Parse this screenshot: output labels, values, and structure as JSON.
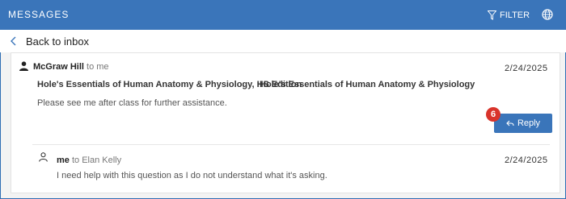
{
  "header": {
    "title": "MESSAGES",
    "filter_label": "FILTER"
  },
  "nav": {
    "back_label": "Back to inbox"
  },
  "thread": {
    "messages": [
      {
        "sender": "McGraw Hill",
        "recipient_text": "to me",
        "date": "2/24/2025",
        "books": [
          "Hole's Essentials of Human Anatomy & Physiology, HS Edition",
          "Hole's Essentials of Human Anatomy & Physiology"
        ],
        "body": "Please see me after class for further assistance."
      },
      {
        "sender": "me",
        "recipient_text": "to Elan Kelly",
        "date": "2/24/2025",
        "body": "I need help with this question as I do not understand what it's asking."
      }
    ],
    "reply_label": "Reply",
    "badge": "6"
  },
  "icons": {
    "filter": "filter-icon",
    "globe": "globe-icon",
    "back": "chevron-left-icon",
    "user_filled": "user-icon",
    "user_outline": "user-outline-icon",
    "reply": "reply-arrow-icon"
  },
  "colors": {
    "header_bg": "#3a75ba",
    "reply_bg": "#3a75ba",
    "badge_bg": "#d9342b"
  }
}
